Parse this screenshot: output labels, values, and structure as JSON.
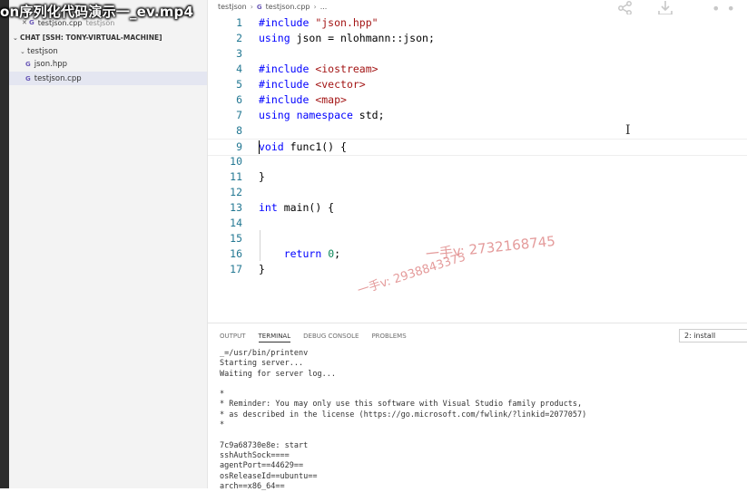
{
  "video_title": "on序列化代码演示一_ev.mp4",
  "sidebar": {
    "open_editor_file": "testjson.cpp",
    "open_editor_folder": "testjson",
    "section_title": "CHAT [SSH: TONY-VIRTUAL-MACHINE]",
    "folder": "testjson",
    "files": [
      {
        "name": "json.hpp",
        "glyph": "G",
        "selected": false
      },
      {
        "name": "testjson.cpp",
        "glyph": "G",
        "selected": true
      }
    ]
  },
  "breadcrumb": {
    "folder": "testjson",
    "file": "testjson.cpp",
    "tail": "..."
  },
  "editor": {
    "lines": [
      {
        "n": "1",
        "segs": [
          [
            "kw",
            "#include"
          ],
          [
            "",
            " "
          ],
          [
            "str",
            "\"json.hpp\""
          ]
        ]
      },
      {
        "n": "2",
        "segs": [
          [
            "kw",
            "using"
          ],
          [
            "",
            " json = nlohmann::json;"
          ]
        ]
      },
      {
        "n": "3",
        "segs": []
      },
      {
        "n": "4",
        "segs": [
          [
            "kw",
            "#include"
          ],
          [
            "",
            " "
          ],
          [
            "str",
            "<iostream>"
          ]
        ]
      },
      {
        "n": "5",
        "segs": [
          [
            "kw",
            "#include"
          ],
          [
            "",
            " "
          ],
          [
            "str",
            "<vector>"
          ]
        ]
      },
      {
        "n": "6",
        "segs": [
          [
            "kw",
            "#include"
          ],
          [
            "",
            " "
          ],
          [
            "str",
            "<map>"
          ]
        ]
      },
      {
        "n": "7",
        "segs": [
          [
            "kw",
            "using"
          ],
          [
            "",
            " "
          ],
          [
            "kw",
            "namespace"
          ],
          [
            "",
            " std;"
          ]
        ]
      },
      {
        "n": "8",
        "segs": []
      },
      {
        "n": "9",
        "segs": [
          [
            "kw",
            "void"
          ],
          [
            "",
            " func1() {"
          ]
        ]
      },
      {
        "n": "10",
        "segs": []
      },
      {
        "n": "11",
        "segs": [
          [
            "",
            "}"
          ]
        ]
      },
      {
        "n": "12",
        "segs": []
      },
      {
        "n": "13",
        "segs": [
          [
            "kw",
            "int"
          ],
          [
            "",
            " main() {"
          ]
        ]
      },
      {
        "n": "14",
        "segs": []
      },
      {
        "n": "15",
        "segs": []
      },
      {
        "n": "16",
        "segs": [
          [
            "",
            "    "
          ],
          [
            "kw",
            "return"
          ],
          [
            "",
            " "
          ],
          [
            "num",
            "0"
          ],
          [
            "",
            ";"
          ]
        ]
      },
      {
        "n": "17",
        "segs": [
          [
            "",
            "}"
          ]
        ]
      }
    ]
  },
  "watermarks": {
    "line1": "一手v: 2938843375",
    "line2": "一手v: 2732168745"
  },
  "panel": {
    "tabs": [
      "OUTPUT",
      "TERMINAL",
      "DEBUG CONSOLE",
      "PROBLEMS"
    ],
    "active_tab": "TERMINAL",
    "terminal_select": "2: install",
    "terminal_lines": [
      "_=/usr/bin/printenv",
      "Starting server...",
      "Waiting for server log...",
      "",
      "*",
      "* Reminder: You may only use this software with Visual Studio family products,",
      "* as described in the license (https://go.microsoft.com/fwlink/?linkid=2077057)",
      "*",
      "",
      "7c9a68730e8e: start",
      "sshAuthSock====",
      "agentPort==44629==",
      "osReleaseId==ubuntu==",
      "arch==x86_64=="
    ]
  },
  "icons": {
    "share": "share-icon",
    "download": "download-icon",
    "more": "more-icon"
  }
}
